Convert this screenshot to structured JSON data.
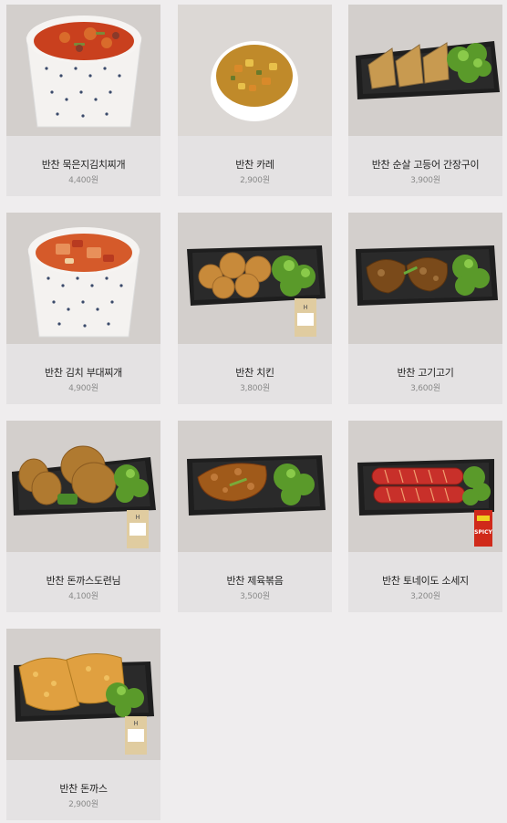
{
  "products": [
    {
      "name": "반찬 묵은지김치찌개",
      "price": "4,400원",
      "image": "stew-bowl-icon"
    },
    {
      "name": "반찬 카레",
      "price": "2,900원",
      "image": "curry-bowl-icon"
    },
    {
      "name": "반찬 순살 고등어 간장구이",
      "price": "3,900원",
      "image": "grilled-mackerel-icon"
    },
    {
      "name": "반찬 김치 부대찌개",
      "price": "4,900원",
      "image": "army-stew-bowl-icon"
    },
    {
      "name": "반찬 치킨",
      "price": "3,800원",
      "image": "fried-chicken-tray-icon"
    },
    {
      "name": "반찬 고기고기",
      "price": "3,600원",
      "image": "meat-tray-icon"
    },
    {
      "name": "반찬 돈까스도련님",
      "price": "4,100원",
      "image": "cutlet-patty-tray-icon"
    },
    {
      "name": "반찬 제육볶음",
      "price": "3,500원",
      "image": "spicy-pork-tray-icon"
    },
    {
      "name": "반찬 토네이도 소세지",
      "price": "3,200원",
      "image": "sausage-tray-icon"
    },
    {
      "name": "반찬 돈까스",
      "price": "2,900원",
      "image": "pork-cutlet-tray-icon"
    }
  ],
  "sauce_packet": {
    "label": "H"
  },
  "sauce_red": {
    "label": "SPICY"
  }
}
